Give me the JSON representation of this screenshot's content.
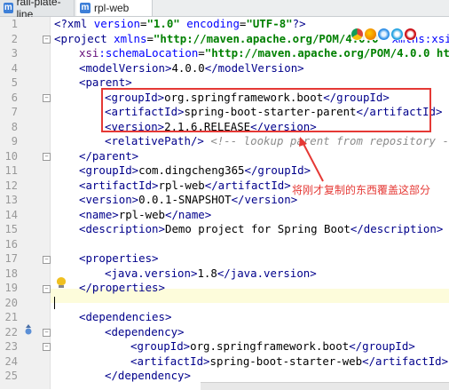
{
  "tabs": [
    {
      "label": "rail-plate-line",
      "icon": "m"
    },
    {
      "label": "rpl-web",
      "icon": "m"
    }
  ],
  "line_numbers": [
    "1",
    "2",
    "3",
    "4",
    "5",
    "6",
    "7",
    "8",
    "9",
    "10",
    "11",
    "12",
    "13",
    "14",
    "15",
    "16",
    "17",
    "18",
    "19",
    "20",
    "21",
    "22",
    "23",
    "24",
    "25"
  ],
  "code": {
    "l1": {
      "a": "<?",
      "b": "xml ",
      "c": "version",
      "d": "=",
      "e": "\"1.0\"",
      "f": " ",
      "g": "encoding",
      "h": "=",
      "i": "\"UTF-8\"",
      "j": "?>"
    },
    "l2": {
      "a": "<project ",
      "b": "xmlns",
      "c": "=",
      "d": "\"http://maven.apache.org/POM/4.0.0\"",
      "e": " xmlns:xsi=\""
    },
    "l3": {
      "a": "xsi",
      "b": ":schemaLocation",
      "c": "=",
      "d": "\"http://maven.apache.org/POM/4.0.0 htt"
    },
    "l4": {
      "a": "<modelVersion>",
      "b": "4.0.0",
      "c": "</modelVersion>"
    },
    "l5": {
      "a": "<parent>"
    },
    "l6": {
      "a": "<groupId>",
      "b": "org.springframework.boot",
      "c": "</groupId>"
    },
    "l7": {
      "a": "<artifactId>",
      "b": "spring-boot-starter-parent",
      "c": "</artifactId>"
    },
    "l8": {
      "a": "<version>",
      "b": "2.1.6.RELEASE",
      "c": "</version>"
    },
    "l9": {
      "a": "<relativePath/>",
      "b": " <!-- lookup parent from repository -->"
    },
    "l10": {
      "a": "</parent>"
    },
    "l11": {
      "a": "<groupId>",
      "b": "com.dingcheng365",
      "c": "</groupId>"
    },
    "l12": {
      "a": "<artifactId>",
      "b": "rpl-web",
      "c": "</artifactId>"
    },
    "l13": {
      "a": "<version>",
      "b": "0.0.1-SNAPSHOT",
      "c": "</version>"
    },
    "l14": {
      "a": "<name>",
      "b": "rpl-web",
      "c": "</name>"
    },
    "l15": {
      "a": "<description>",
      "b": "Demo project for Spring Boot",
      "c": "</description>"
    },
    "l17": {
      "a": "<properties>"
    },
    "l18": {
      "a": "<java.version>",
      "b": "1.8",
      "c": "</java.version>"
    },
    "l19": {
      "a": "</properties>"
    },
    "l21": {
      "a": "<dependencies>"
    },
    "l22": {
      "a": "<dependency>"
    },
    "l23": {
      "a": "<groupId>",
      "b": "org.springframework.boot",
      "c": "</groupId>"
    },
    "l24": {
      "a": "<artifactId>",
      "b": "spring-boot-starter-web",
      "c": "</artifactId>"
    },
    "l25": {
      "a": "</dependency>"
    }
  },
  "annotation": "将刚才复制的东西覆盖这部分",
  "colors": {
    "annotation": "#e53935",
    "tag": "#00008b",
    "attr": "#0000ff",
    "string": "#008000"
  },
  "icons": [
    "maven-module-icon",
    "lightbulb-icon",
    "override-marker-icon",
    "chrome-icon",
    "firefox-icon",
    "safari-icon",
    "ie-icon",
    "opera-icon"
  ]
}
